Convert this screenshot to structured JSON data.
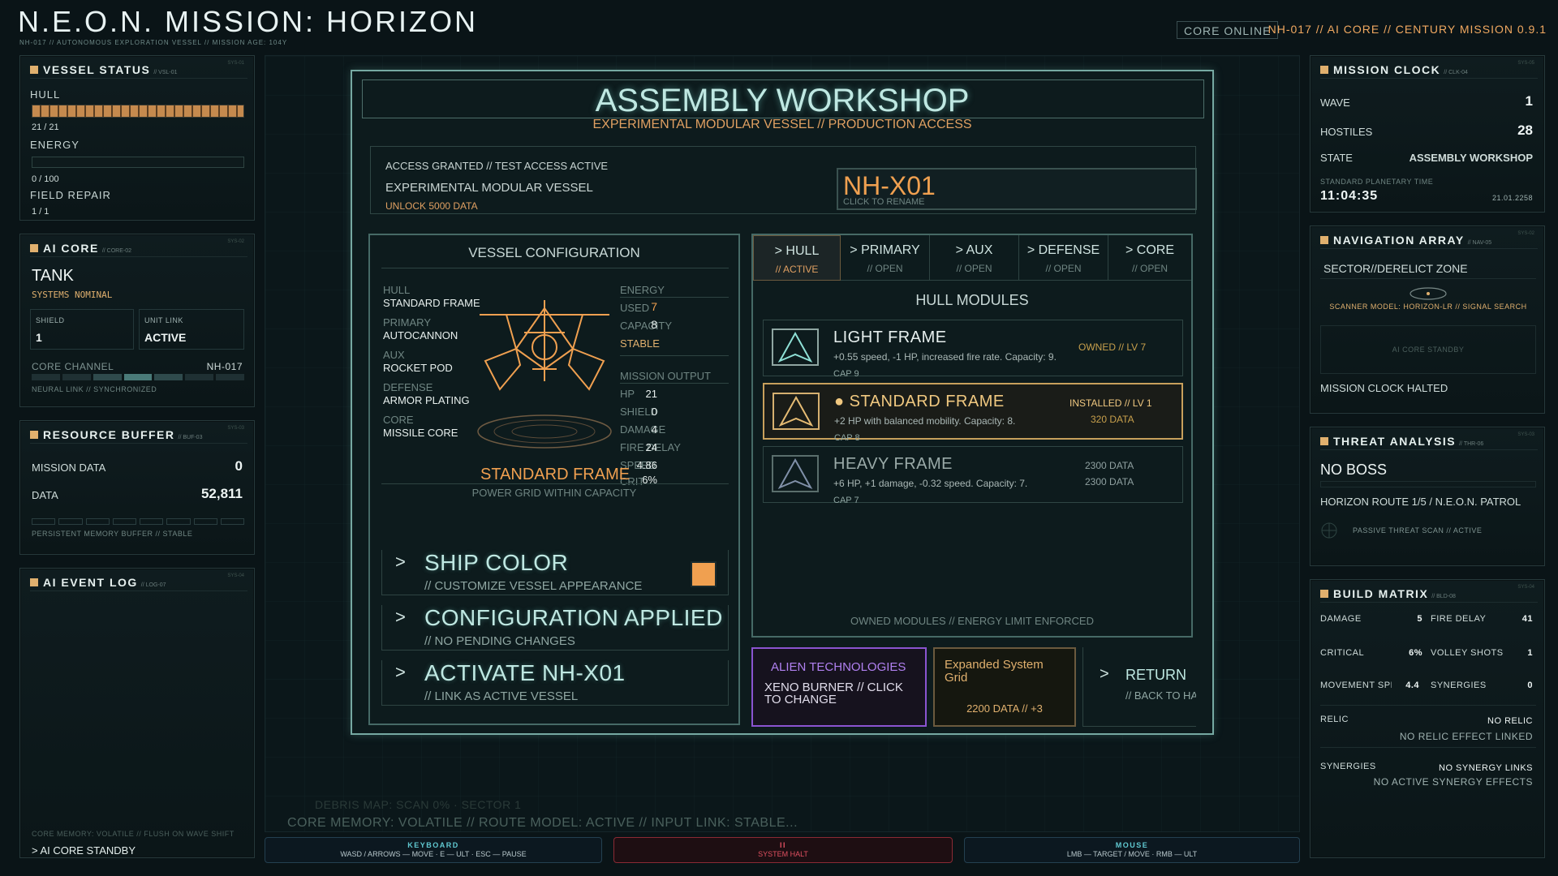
{
  "header": {
    "title": "N.E.O.N. MISSION: HORIZON",
    "subtitle": "NH-017 // AUTONOMOUS EXPLORATION VESSEL // MISSION AGE: 104Y",
    "status": "CORE ONLINE",
    "id_line": "NH-017 // AI CORE // CENTURY MISSION 0.9.1"
  },
  "vessel_status": {
    "title": "VESSEL STATUS",
    "code": "// VSL-01",
    "sys": "SYS-01",
    "hull_label": "HULL",
    "hull_value": "21 / 21",
    "hull_fraction": 1.0,
    "energy_label": "ENERGY",
    "energy_value": "0 / 100",
    "energy_fraction": 0.0,
    "field_repair_label": "FIELD REPAIR",
    "field_repair_value": "1 / 1"
  },
  "ai_core": {
    "title": "AI CORE",
    "code": "// CORE-02",
    "sys": "SYS-02",
    "mode": "TANK",
    "status": "SYSTEMS NOMINAL",
    "shield_label": "SHIELD",
    "shield_value": "1",
    "unit_link_label": "UNIT LINK",
    "unit_link_value": "ACTIVE",
    "channel_label": "CORE CHANNEL",
    "channel_value": "NH-017",
    "neural": "NEURAL LINK // SYNCHRONIZED"
  },
  "resource_buffer": {
    "title": "RESOURCE BUFFER",
    "code": "// BUF-03",
    "sys": "SYS-03",
    "mission_data_label": "MISSION DATA",
    "mission_data_value": "0",
    "data_label": "DATA",
    "data_value": "52,811",
    "foot": "PERSISTENT MEMORY BUFFER // STABLE"
  },
  "event_log": {
    "title": "AI EVENT LOG",
    "code": "// LOG-07",
    "sys": "SYS-04",
    "foot": "CORE MEMORY: VOLATILE // FLUSH ON WAVE SHIFT",
    "prompt": "> AI CORE STANDBY"
  },
  "mission_clock": {
    "title": "MISSION CLOCK",
    "code": "// CLK-04",
    "sys": "SYS-05",
    "wave_label": "WAVE",
    "wave_value": "1",
    "hostiles_label": "HOSTILES",
    "hostiles_value": "28",
    "state_label": "STATE",
    "state_value": "ASSEMBLY WORKSHOP",
    "spt_label": "STANDARD PLANETARY TIME",
    "time": "11:04:35",
    "date": "21.01.2258"
  },
  "navigation": {
    "title": "NAVIGATION ARRAY",
    "code": "// NAV-05",
    "sys": "SYS-02",
    "sector": "SECTOR//DERELICT ZONE",
    "scanner": "SCANNER MODEL: HORIZON-LR // SIGNAL SEARCH",
    "standby": "AI CORE STANDBY",
    "clock": "MISSION CLOCK HALTED"
  },
  "threat": {
    "title": "THREAT ANALYSIS",
    "code": "// THR-06",
    "sys": "SYS-03",
    "boss": "NO BOSS",
    "route": "HORIZON ROUTE 1/5 / N.E.O.N. PATROL",
    "passive": "PASSIVE THREAT SCAN // ACTIVE"
  },
  "build_matrix": {
    "title": "BUILD MATRIX",
    "code": "// BLD-08",
    "sys": "SYS-04",
    "damage_label": "DAMAGE",
    "damage_value": "5",
    "fire_delay_label": "FIRE DELAY",
    "fire_delay_value": "41",
    "critical_label": "CRITICAL",
    "critical_value": "6%",
    "volley_label": "VOLLEY SHOTS",
    "volley_value": "1",
    "move_label": "MOVEMENT SPEED",
    "move_value": "4.4",
    "syn_label": "SYNERGIES",
    "syn_value": "0",
    "relic_label": "RELIC",
    "relic_value": "NO RELIC",
    "relic_note": "NO RELIC EFFECT LINKED",
    "synergies_label": "SYNERGIES",
    "synergies_value": "NO SYNERGY LINKS",
    "synergies_note": "NO ACTIVE SYNERGY EFFECTS"
  },
  "workshop": {
    "title": "ASSEMBLY WORKSHOP",
    "subtitle": "EXPERIMENTAL MODULAR VESSEL // PRODUCTION ACCESS",
    "access": "ACCESS GRANTED // TEST ACCESS ACTIVE",
    "vessel": "EXPERIMENTAL MODULAR VESSEL",
    "unlock": "UNLOCK 5000 DATA",
    "name": "NH-X01",
    "rename": "CLICK TO RENAME"
  },
  "config": {
    "title": "VESSEL CONFIGURATION",
    "slots": [
      {
        "k": "HULL",
        "v": "STANDARD FRAME"
      },
      {
        "k": "PRIMARY",
        "v": "AUTOCANNON"
      },
      {
        "k": "AUX",
        "v": "ROCKET POD"
      },
      {
        "k": "DEFENSE",
        "v": "ARMOR PLATING"
      },
      {
        "k": "CORE",
        "v": "MISSILE CORE"
      }
    ],
    "energy_label": "ENERGY",
    "used_label": "USED",
    "used_value": "7",
    "capacity_label": "CAPACITY",
    "capacity_value": "8",
    "stable": "STABLE",
    "output_label": "MISSION OUTPUT",
    "hp_label": "HP",
    "hp_value": "21",
    "shield_label": "SHIELD",
    "shield_value": "0",
    "damage_label": "DAMAGE",
    "damage_value": "4",
    "firedelay_label": "FIRE DELAY",
    "firedelay_value": "24",
    "speed_label": "SPEED",
    "speed_value": "4.86",
    "crit_label": "CRIT",
    "crit_value": "6%",
    "ship_label": "STANDARD FRAME",
    "ship_note": "POWER GRID WITHIN CAPACITY",
    "color_title": "SHIP COLOR",
    "color_sub": "// CUSTOMIZE VESSEL APPEARANCE",
    "ship_color": "#f0a050",
    "applied_title": "CONFIGURATION APPLIED",
    "applied_sub": "// NO PENDING CHANGES",
    "activate_title": "ACTIVATE NH-X01",
    "activate_sub": "// LINK AS ACTIVE VESSEL",
    "chevron": ">"
  },
  "modules": {
    "tabs": [
      {
        "label": "> HULL",
        "state": "// ACTIVE"
      },
      {
        "label": "> PRIMARY",
        "state": "// OPEN"
      },
      {
        "label": "> AUX",
        "state": "// OPEN"
      },
      {
        "label": "> DEFENSE",
        "state": "// OPEN"
      },
      {
        "label": "> CORE",
        "state": "// OPEN"
      }
    ],
    "title": "HULL MODULES",
    "items": [
      {
        "name": "LIGHT FRAME",
        "desc": "+0.55 speed, -1 HP, increased fire rate. Capacity: 9.",
        "cap": "CAP 9",
        "status": "OWNED // LV 7",
        "price": ""
      },
      {
        "name": "● STANDARD FRAME",
        "desc": "+2 HP with balanced mobility. Capacity: 8.",
        "cap": "CAP 8",
        "status": "INSTALLED // LV 1",
        "price": "320 DATA"
      },
      {
        "name": "HEAVY FRAME",
        "desc": "+6 HP, +1 damage, -0.32 speed. Capacity: 7.",
        "cap": "CAP 7",
        "status": "2300 DATA",
        "price": "2300 DATA"
      }
    ],
    "foot": "OWNED MODULES // ENERGY LIMIT ENFORCED"
  },
  "bottom": {
    "alien_title": "ALIEN TECHNOLOGIES",
    "alien_sub": "XENO BURNER // CLICK TO CHANGE",
    "grid_title": "Expanded System Grid",
    "grid_price": "2200 DATA // +3",
    "return_title": "RETURN",
    "return_sub": "// BACK TO HA",
    "return_chev": ">",
    "hint_ghost": "DEBRIS MAP: SCAN 0% · SECTOR 1",
    "hint": "CORE MEMORY: VOLATILE // ROUTE MODEL: ACTIVE // INPUT LINK: STABLE..."
  },
  "keybar": {
    "keyboard_title": "KEYBOARD",
    "keyboard_text": "WASD / ARROWS — MOVE · E — ULT · ESC — PAUSE",
    "halt_title": "II",
    "halt_text": "SYSTEM HALT",
    "mouse_title": "MOUSE",
    "mouse_text": "LMB — TARGET / MOVE · RMB — ULT"
  }
}
